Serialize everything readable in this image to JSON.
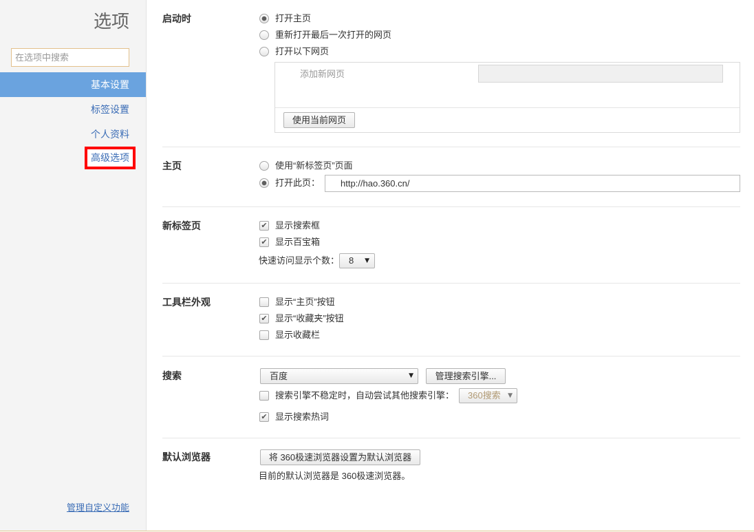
{
  "sidebar": {
    "title": "选项",
    "search_placeholder": "在选项中搜索",
    "nav": [
      {
        "label": "基本设置",
        "selected": true,
        "highlighted": false
      },
      {
        "label": "标签设置",
        "selected": false,
        "highlighted": false
      },
      {
        "label": "个人资料",
        "selected": false,
        "highlighted": false
      },
      {
        "label": "高级选项",
        "selected": false,
        "highlighted": true
      }
    ],
    "footer_link": "管理自定义功能"
  },
  "startup": {
    "label": "启动时",
    "options": [
      {
        "label": "打开主页",
        "checked": true
      },
      {
        "label": "重新打开最后一次打开的网页",
        "checked": false
      },
      {
        "label": "打开以下网页",
        "checked": false
      }
    ],
    "add_page_label": "添加新网页",
    "add_page_value": "",
    "use_current_button": "使用当前网页"
  },
  "homepage": {
    "label": "主页",
    "options": [
      {
        "label": "使用“新标签页”页面",
        "checked": false
      },
      {
        "label": "打开此页：",
        "checked": true
      }
    ],
    "url": "http://hao.360.cn/"
  },
  "new_tab": {
    "label": "新标签页",
    "options": [
      {
        "label": "显示搜索框",
        "checked": true
      },
      {
        "label": "显示百宝箱",
        "checked": true
      }
    ],
    "quick_access_label": "快速访问显示个数：",
    "quick_access_count": "8"
  },
  "toolbar": {
    "label": "工具栏外观",
    "options": [
      {
        "label": "显示“主页”按钮",
        "checked": false
      },
      {
        "label": "显示“收藏夹”按钮",
        "checked": true
      },
      {
        "label": "显示收藏栏",
        "checked": false
      }
    ]
  },
  "search": {
    "label": "搜索",
    "engine": "百度",
    "manage_button": "管理搜索引擎...",
    "fallback": {
      "label": "搜索引擎不稳定时，自动尝试其他搜索引擎：",
      "checked": false,
      "engine": "360搜索",
      "engine_disabled": true
    },
    "hot_words": {
      "label": "显示搜索热词",
      "checked": true
    }
  },
  "default_browser": {
    "label": "默认浏览器",
    "set_default_button": "将 360极速浏览器设置为默认浏览器",
    "status_text": "目前的默认浏览器是 360极速浏览器。"
  },
  "icons": {
    "checkmark": "✔",
    "dropdown_arrow": "▼"
  },
  "colors": {
    "accent": "#6aa3df",
    "link": "#3b6db6",
    "highlight_box": "#ff0000",
    "bottom_rule": "#e0c58f"
  }
}
